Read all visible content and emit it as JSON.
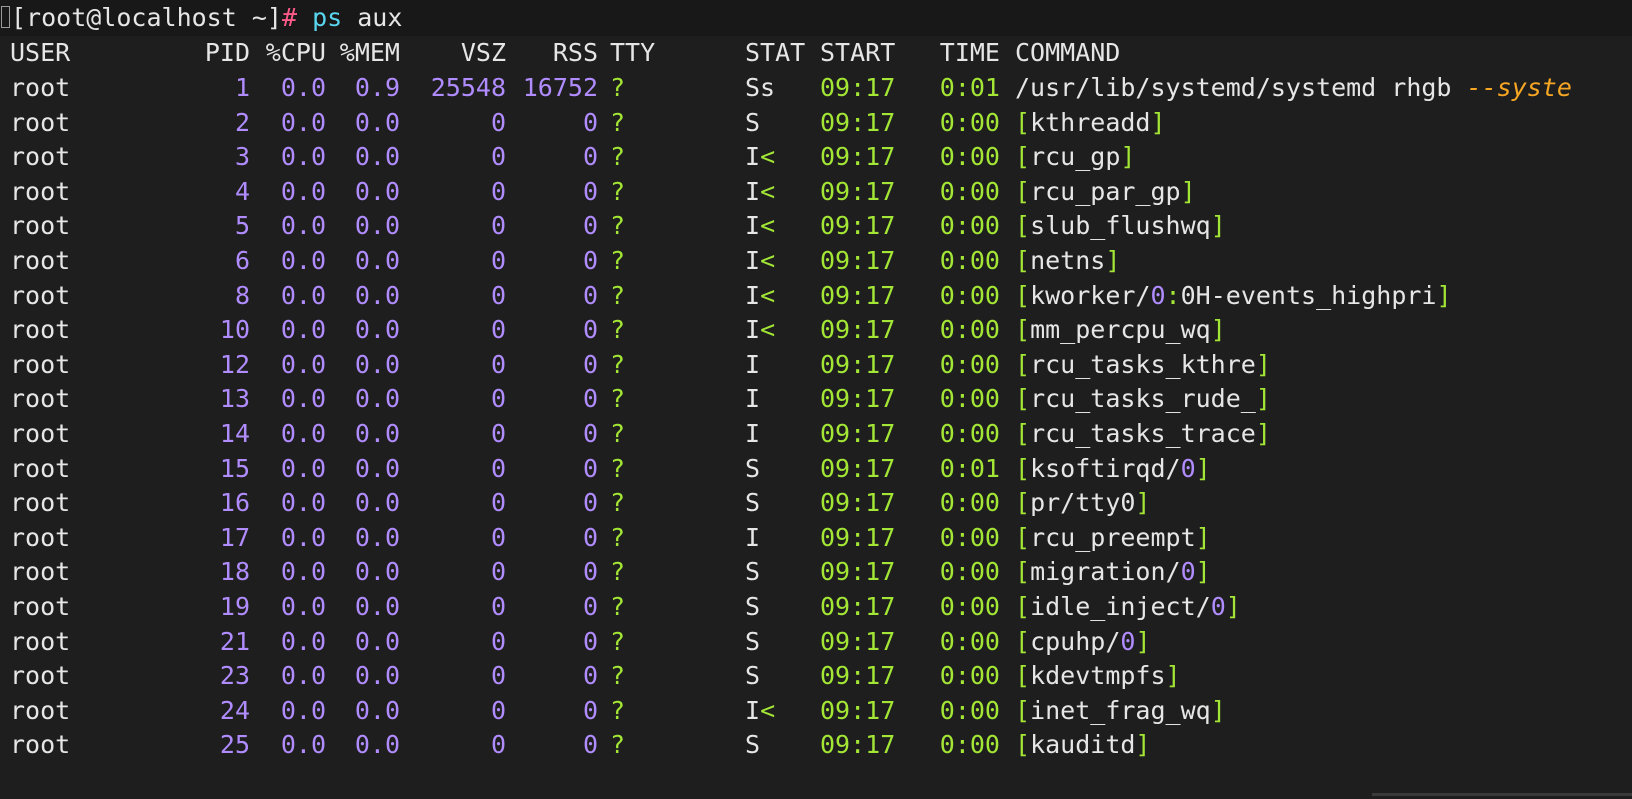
{
  "prompt": {
    "user_host": "[root@localhost ~]",
    "hash": "#",
    "cmd": "ps",
    "args": " aux"
  },
  "header": {
    "user": "USER",
    "pid": "PID",
    "cpu": "%CPU",
    "mem": "%MEM",
    "vsz": "VSZ",
    "rss": "RSS",
    "tty": "TTY",
    "stat": "STAT",
    "start": "START",
    "time": "TIME",
    "command": "COMMAND"
  },
  "rows": [
    {
      "user": "root",
      "pid": "1",
      "cpu": "0.0",
      "mem": "0.9",
      "vsz": "25548",
      "rss": "16752",
      "tty": "?",
      "stat": "Ss",
      "stat_suffix": "",
      "start": "09:17",
      "time": "0:01",
      "cmd_pre": "/usr/lib/systemd/systemd rhgb ",
      "cmd_arg": "--syste",
      "bracket": false,
      "cmd": ""
    },
    {
      "user": "root",
      "pid": "2",
      "cpu": "0.0",
      "mem": "0.0",
      "vsz": "0",
      "rss": "0",
      "tty": "?",
      "stat": "S",
      "stat_suffix": "",
      "start": "09:17",
      "time": "0:00",
      "bracket": true,
      "cmd": "kthreadd"
    },
    {
      "user": "root",
      "pid": "3",
      "cpu": "0.0",
      "mem": "0.0",
      "vsz": "0",
      "rss": "0",
      "tty": "?",
      "stat": "I",
      "stat_suffix": "<",
      "start": "09:17",
      "time": "0:00",
      "bracket": true,
      "cmd": "rcu_gp"
    },
    {
      "user": "root",
      "pid": "4",
      "cpu": "0.0",
      "mem": "0.0",
      "vsz": "0",
      "rss": "0",
      "tty": "?",
      "stat": "I",
      "stat_suffix": "<",
      "start": "09:17",
      "time": "0:00",
      "bracket": true,
      "cmd": "rcu_par_gp"
    },
    {
      "user": "root",
      "pid": "5",
      "cpu": "0.0",
      "mem": "0.0",
      "vsz": "0",
      "rss": "0",
      "tty": "?",
      "stat": "I",
      "stat_suffix": "<",
      "start": "09:17",
      "time": "0:00",
      "bracket": true,
      "cmd": "slub_flushwq"
    },
    {
      "user": "root",
      "pid": "6",
      "cpu": "0.0",
      "mem": "0.0",
      "vsz": "0",
      "rss": "0",
      "tty": "?",
      "stat": "I",
      "stat_suffix": "<",
      "start": "09:17",
      "time": "0:00",
      "bracket": true,
      "cmd": "netns"
    },
    {
      "user": "root",
      "pid": "8",
      "cpu": "0.0",
      "mem": "0.0",
      "vsz": "0",
      "rss": "0",
      "tty": "?",
      "stat": "I",
      "stat_suffix": "<",
      "start": "09:17",
      "time": "0:00",
      "bracket": true,
      "cmd": "kworker/0:0H-events_highpri"
    },
    {
      "user": "root",
      "pid": "10",
      "cpu": "0.0",
      "mem": "0.0",
      "vsz": "0",
      "rss": "0",
      "tty": "?",
      "stat": "I",
      "stat_suffix": "<",
      "start": "09:17",
      "time": "0:00",
      "bracket": true,
      "cmd": "mm_percpu_wq"
    },
    {
      "user": "root",
      "pid": "12",
      "cpu": "0.0",
      "mem": "0.0",
      "vsz": "0",
      "rss": "0",
      "tty": "?",
      "stat": "I",
      "stat_suffix": "",
      "start": "09:17",
      "time": "0:00",
      "bracket": true,
      "cmd": "rcu_tasks_kthre"
    },
    {
      "user": "root",
      "pid": "13",
      "cpu": "0.0",
      "mem": "0.0",
      "vsz": "0",
      "rss": "0",
      "tty": "?",
      "stat": "I",
      "stat_suffix": "",
      "start": "09:17",
      "time": "0:00",
      "bracket": true,
      "cmd": "rcu_tasks_rude_"
    },
    {
      "user": "root",
      "pid": "14",
      "cpu": "0.0",
      "mem": "0.0",
      "vsz": "0",
      "rss": "0",
      "tty": "?",
      "stat": "I",
      "stat_suffix": "",
      "start": "09:17",
      "time": "0:00",
      "bracket": true,
      "cmd": "rcu_tasks_trace"
    },
    {
      "user": "root",
      "pid": "15",
      "cpu": "0.0",
      "mem": "0.0",
      "vsz": "0",
      "rss": "0",
      "tty": "?",
      "stat": "S",
      "stat_suffix": "",
      "start": "09:17",
      "time": "0:01",
      "bracket": true,
      "cmd": "ksoftirqd/0"
    },
    {
      "user": "root",
      "pid": "16",
      "cpu": "0.0",
      "mem": "0.0",
      "vsz": "0",
      "rss": "0",
      "tty": "?",
      "stat": "S",
      "stat_suffix": "",
      "start": "09:17",
      "time": "0:00",
      "bracket": true,
      "cmd": "pr/tty0"
    },
    {
      "user": "root",
      "pid": "17",
      "cpu": "0.0",
      "mem": "0.0",
      "vsz": "0",
      "rss": "0",
      "tty": "?",
      "stat": "I",
      "stat_suffix": "",
      "start": "09:17",
      "time": "0:00",
      "bracket": true,
      "cmd": "rcu_preempt"
    },
    {
      "user": "root",
      "pid": "18",
      "cpu": "0.0",
      "mem": "0.0",
      "vsz": "0",
      "rss": "0",
      "tty": "?",
      "stat": "S",
      "stat_suffix": "",
      "start": "09:17",
      "time": "0:00",
      "bracket": true,
      "cmd": "migration/0"
    },
    {
      "user": "root",
      "pid": "19",
      "cpu": "0.0",
      "mem": "0.0",
      "vsz": "0",
      "rss": "0",
      "tty": "?",
      "stat": "S",
      "stat_suffix": "",
      "start": "09:17",
      "time": "0:00",
      "bracket": true,
      "cmd": "idle_inject/0"
    },
    {
      "user": "root",
      "pid": "21",
      "cpu": "0.0",
      "mem": "0.0",
      "vsz": "0",
      "rss": "0",
      "tty": "?",
      "stat": "S",
      "stat_suffix": "",
      "start": "09:17",
      "time": "0:00",
      "bracket": true,
      "cmd": "cpuhp/0"
    },
    {
      "user": "root",
      "pid": "23",
      "cpu": "0.0",
      "mem": "0.0",
      "vsz": "0",
      "rss": "0",
      "tty": "?",
      "stat": "S",
      "stat_suffix": "",
      "start": "09:17",
      "time": "0:00",
      "bracket": true,
      "cmd": "kdevtmpfs"
    },
    {
      "user": "root",
      "pid": "24",
      "cpu": "0.0",
      "mem": "0.0",
      "vsz": "0",
      "rss": "0",
      "tty": "?",
      "stat": "I",
      "stat_suffix": "<",
      "start": "09:17",
      "time": "0:00",
      "bracket": true,
      "cmd": "inet_frag_wq"
    },
    {
      "user": "root",
      "pid": "25",
      "cpu": "0.0",
      "mem": "0.0",
      "vsz": "0",
      "rss": "0",
      "tty": "?",
      "stat": "S",
      "stat_suffix": "",
      "start": "09:17",
      "time": "0:00",
      "bracket": true,
      "cmd": "kauditd"
    }
  ],
  "colors": {
    "background": "#1e1e1e",
    "text": "#e6e6e6",
    "number": "#b08cff",
    "green": "#a3e635",
    "orange": "#f6a623",
    "cyan": "#5ad7f0",
    "pink": "#ff5a8a"
  }
}
